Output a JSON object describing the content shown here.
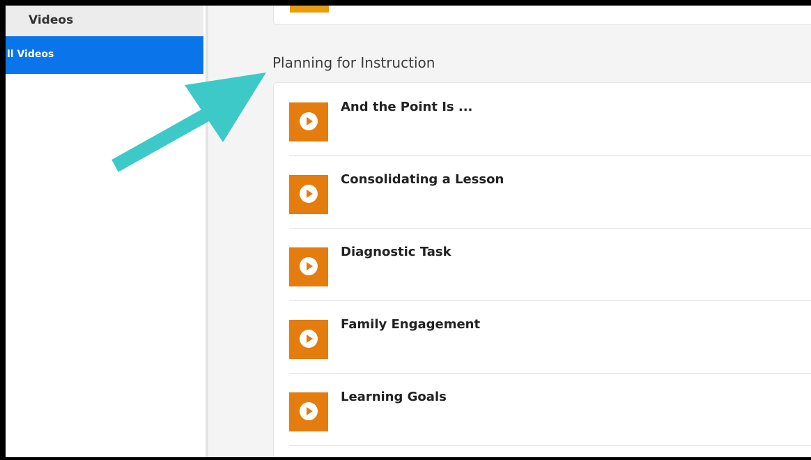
{
  "sidebar": {
    "parent_label": "Videos",
    "active_label": "ll Videos"
  },
  "section": {
    "title": "Planning for Instruction"
  },
  "videos": [
    {
      "title": "And the Point Is ..."
    },
    {
      "title": "Consolidating a Lesson"
    },
    {
      "title": "Diagnostic Task"
    },
    {
      "title": "Family Engagement"
    },
    {
      "title": "Learning Goals"
    }
  ],
  "icons": {
    "video": "play-icon",
    "annotation": "arrow-icon"
  },
  "colors": {
    "active_nav": "#0a75ea",
    "play_tile": "#e47c0e",
    "annotation_arrow": "#3ec9c9"
  }
}
